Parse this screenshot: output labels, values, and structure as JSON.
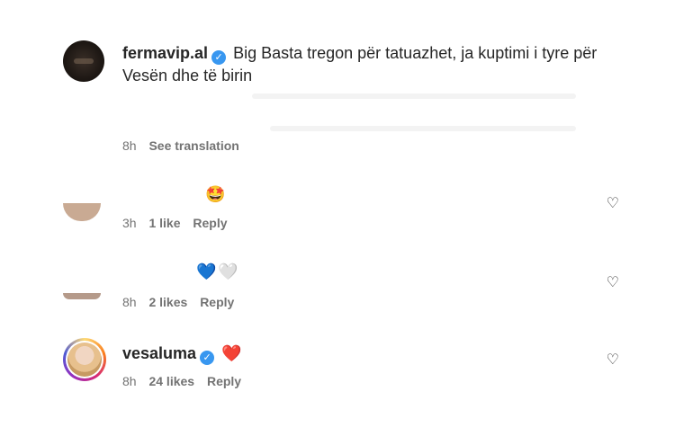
{
  "post": {
    "username": "fermavip.al",
    "caption": "Big Basta tregon për tatuazhet, ja kuptimi i tyre për Vesën dhe të birin",
    "time": "8h",
    "see_translation": "See translation"
  },
  "comments": [
    {
      "emoji": "🤩",
      "time": "3h",
      "likes": "1 like",
      "reply": "Reply"
    },
    {
      "emoji_blue": "💙",
      "emoji_white": "🤍",
      "time": "8h",
      "likes": "2 likes",
      "reply": "Reply"
    },
    {
      "username": "vesaluma",
      "emoji": "❤️",
      "time": "8h",
      "likes": "24 likes",
      "reply": "Reply"
    }
  ],
  "icons": {
    "verified": "verified-badge-icon",
    "like": "heart-outline-icon"
  },
  "colors": {
    "verified": "#3897f0",
    "meta": "#737373",
    "text": "#262626"
  }
}
